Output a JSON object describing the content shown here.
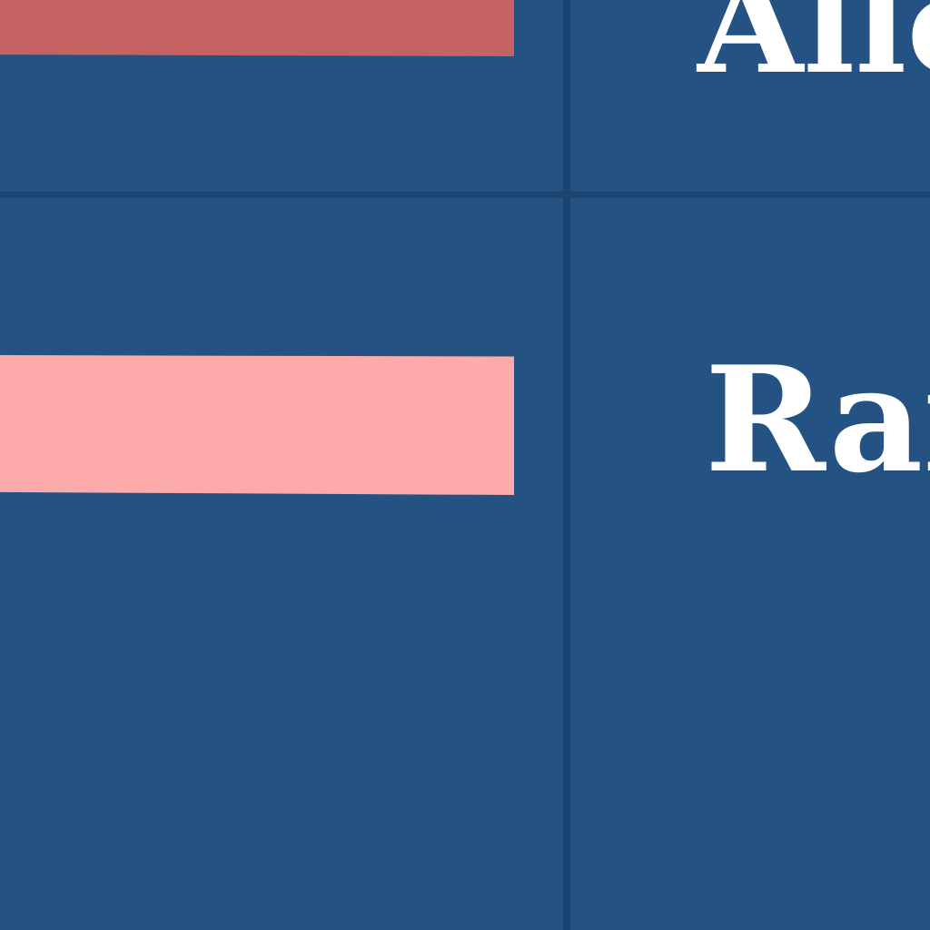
{
  "screen": {
    "background_color": "#245283",
    "grid_line_color": "#1c446e"
  },
  "rows": [
    {
      "label": "Allo",
      "bar_color": "#c66262"
    },
    {
      "label": "Rai",
      "bar_color": "#fcaaaa"
    }
  ]
}
